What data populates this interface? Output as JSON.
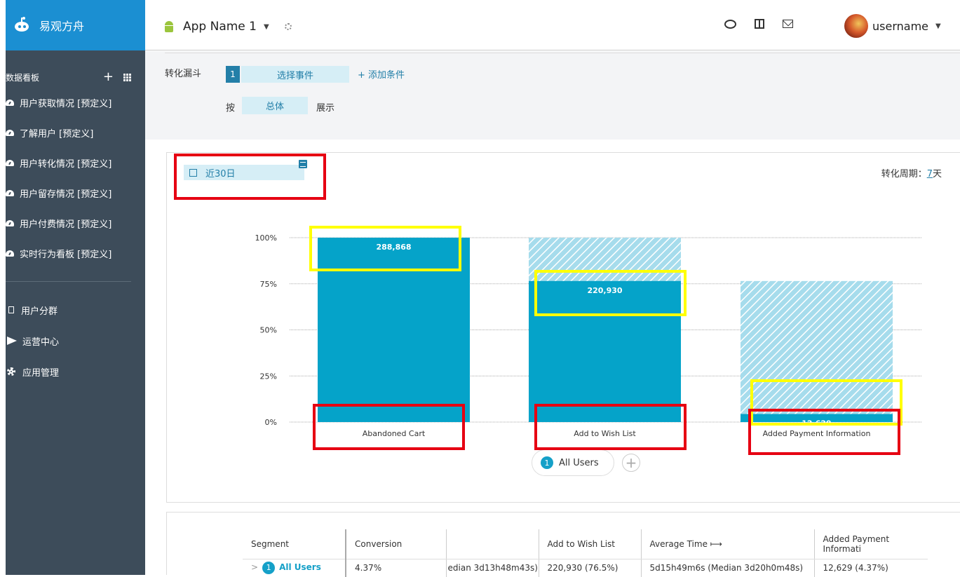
{
  "brand": {
    "name": "易观方舟"
  },
  "sidebar": {
    "section_title": "数据看板",
    "dashboards": [
      {
        "label": "用户获取情况 [预定义]"
      },
      {
        "label": "了解用户 [预定义]"
      },
      {
        "label": "用户转化情况 [预定义]"
      },
      {
        "label": "用户留存情况 [预定义]"
      },
      {
        "label": "用户付费情况 [预定义]"
      },
      {
        "label": "实时行为看板 [预定义]"
      }
    ],
    "nav": [
      {
        "label": "用户分群"
      },
      {
        "label": "运营中心"
      },
      {
        "label": "应用管理"
      }
    ]
  },
  "topbar": {
    "app_name": "App Name 1",
    "username": "username"
  },
  "config": {
    "funnel_label": "转化漏斗",
    "step_number": "1",
    "event_select": "选择事件",
    "add_condition": "+ 添加条件",
    "by_label": "按",
    "by_value": "总体",
    "show_label": "展示"
  },
  "chart_card": {
    "date_range": "近30日",
    "period_label": "转化周期：",
    "period_value": "7",
    "period_unit": "天",
    "legend_number": "1",
    "legend_label": "All Users",
    "add_segment": "+"
  },
  "chart_data": {
    "type": "bar",
    "categories": [
      "Abandoned Cart",
      "Add to Wish List",
      "Added Payment Information"
    ],
    "series": [
      {
        "name": "All Users",
        "values": [
          100,
          76.5,
          4.37
        ],
        "labels": [
          "288,868",
          "220,930",
          "12,629"
        ]
      }
    ],
    "previous_step_ghost": [
      null,
      100,
      76.5
    ],
    "yticks": [
      "0%",
      "25%",
      "50%",
      "75%",
      "100%"
    ],
    "ylim": [
      0,
      100
    ],
    "colors": {
      "bar": "#05a3c9",
      "ghost": "#a6dcec"
    }
  },
  "table": {
    "headers": [
      "Segment",
      "Conversion",
      "",
      "Add to Wish List",
      "Average Time ⟼",
      "Added Payment Informati"
    ],
    "row": {
      "expand": ">",
      "seg_number": "1",
      "segment": "All Users",
      "conversion": "4.37%",
      "avg_time_1": "edian 3d13h48m43s)",
      "step2": "220,930 (76.5%)",
      "avg_time_2": "5d15h49m6s (Median 3d20h0m48s)",
      "step3": "12,629 (4.37%)"
    }
  }
}
